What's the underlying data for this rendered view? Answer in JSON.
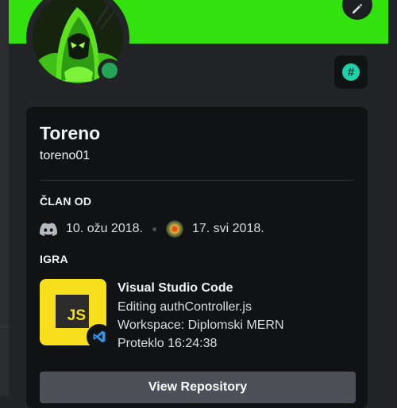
{
  "profile": {
    "display_name": "Toreno",
    "username": "toreno01",
    "status": "online",
    "avatar_icon": "hooded-figure-avatar",
    "badge_icon": "hashtag-icon",
    "banner_color": "#32e10e"
  },
  "member_since": {
    "title": "ČLAN OD",
    "discord_date": "10. ožu 2018.",
    "server_date": "17. svi 2018."
  },
  "activity": {
    "title": "IGRA",
    "tile_text": "JS",
    "app_name": "Visual Studio Code",
    "details": "Editing authController.js",
    "state": "Workspace: Diplomski MERN",
    "elapsed": "Proteklo 16:24:38"
  },
  "buttons": {
    "view_repository": "View Repository"
  }
}
